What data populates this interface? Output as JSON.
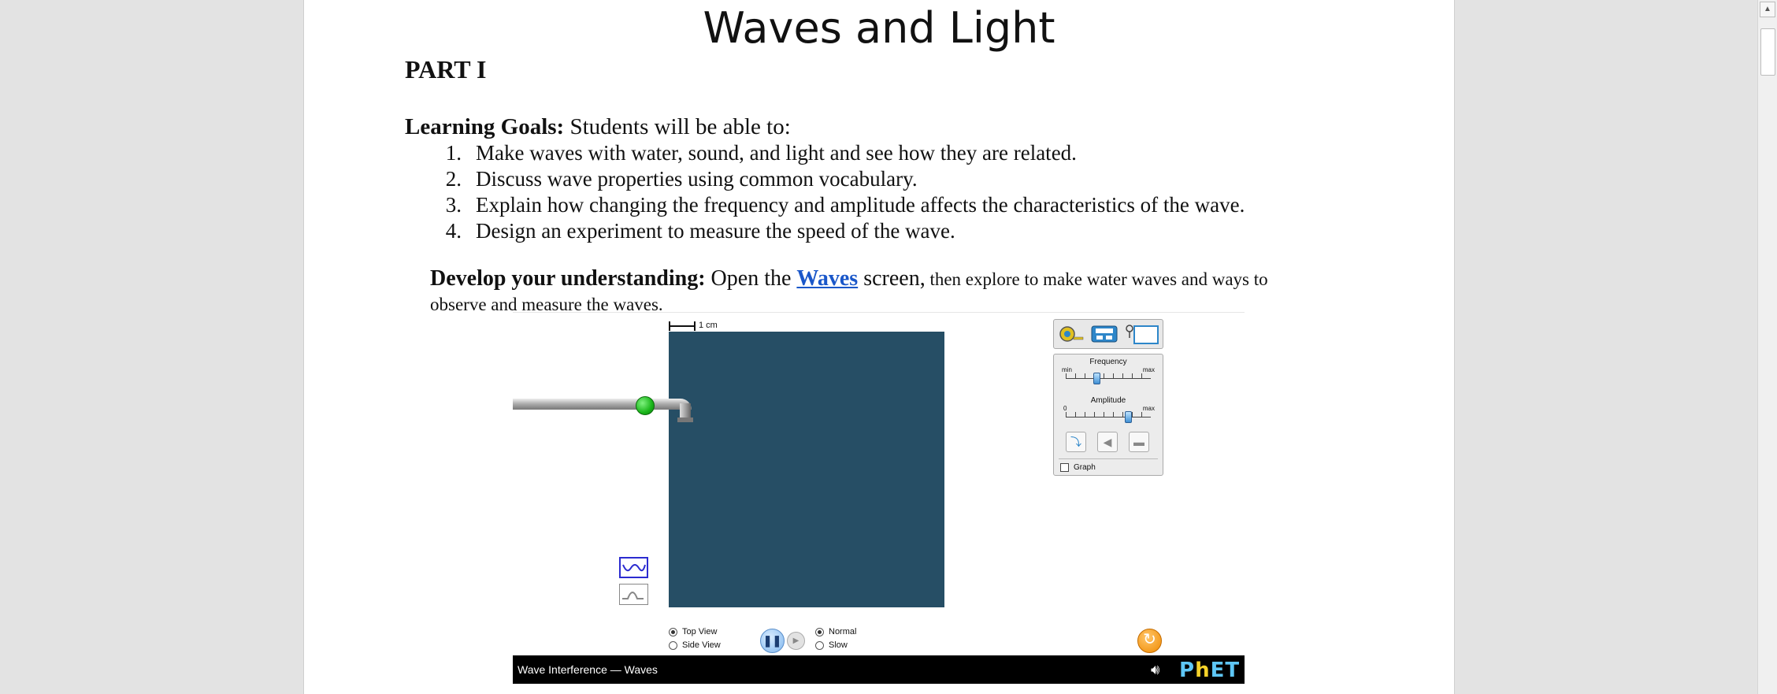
{
  "document": {
    "title": "Waves and Light",
    "part": "PART I",
    "learning_goals_label": "Learning Goals:",
    "learning_goals_text": " Students will be able to:",
    "goals": [
      {
        "num": "1.",
        "text": "Make waves with water, sound, and light and see how they are related."
      },
      {
        "num": "2.",
        "text": "Discuss wave properties using common vocabulary."
      },
      {
        "num": "3.",
        "text": "Explain how changing the frequency and amplitude affects the characteristics of the wave."
      },
      {
        "num": "4.",
        "text": "Design an experiment to measure the speed of the wave."
      }
    ],
    "develop_label": "Develop your understanding:",
    "develop_open": " Open the ",
    "develop_link": "Waves",
    "develop_screen": " screen,",
    "develop_rest_1": " then explore to make water waves and ways to",
    "develop_rest_2": "observe and measure the waves."
  },
  "simulation": {
    "scale_label": "1 cm",
    "frequency_label": "Frequency",
    "frequency_min": "min",
    "frequency_max": "max",
    "frequency_level": 0.37,
    "amplitude_label": "Amplitude",
    "amplitude_min": "0",
    "amplitude_max": "max",
    "amplitude_level": 0.74,
    "graph_label": "Graph",
    "top_view_label": "Top View",
    "side_view_label": "Side View",
    "normal_label": "Normal",
    "slow_label": "Slow",
    "footer_title": "Wave Interference — Waves",
    "logo_text_a": "P",
    "logo_text_h": "h",
    "logo_text_b": "ET",
    "colors": {
      "water": "#264e65",
      "accent": "#1a57c9",
      "reset": "#f08a00",
      "knob": "#19b519"
    }
  }
}
